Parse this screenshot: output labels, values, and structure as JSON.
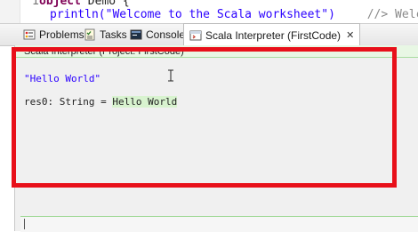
{
  "editor": {
    "line_number": "1",
    "keyword": "object",
    "object_name": "Demo {",
    "line2_code": "println(\"Welcome to the Scala worksheet\")",
    "line2_comment": "//> Welcome"
  },
  "tabs": [
    {
      "label": "Problems",
      "icon": "problems-icon"
    },
    {
      "label": "Tasks",
      "icon": "tasks-icon"
    },
    {
      "label": "Console",
      "icon": "console-icon"
    },
    {
      "label": "Scala Interpreter (FirstCode)",
      "icon": "scala-interpreter-icon",
      "close": "✕"
    }
  ],
  "panel": {
    "header": "Scala Interpreter (Project: FirstCode)",
    "output_line1": "\"Hello World\"",
    "output_line2_prefix": "res0: String = ",
    "output_line2_value": "Hello World"
  },
  "colors": {
    "annotation": "#e8101a",
    "header_bg": "#e8f7e4",
    "string": "#2a00ff"
  }
}
